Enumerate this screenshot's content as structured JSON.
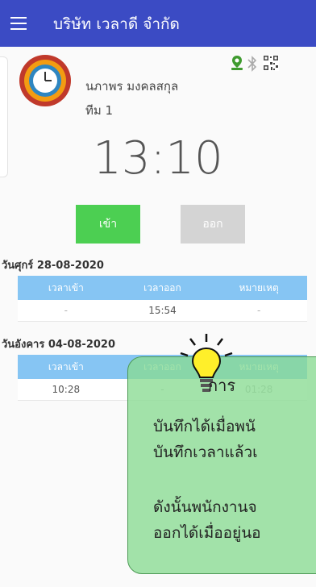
{
  "app_bar": {
    "title": "บริษัท เวลาดี จำกัด"
  },
  "employee": {
    "name": "นภาพร มงคลสกุล",
    "team": "ทีม 1"
  },
  "status_icons": [
    "location-pin-icon",
    "bluetooth-icon",
    "qr-code-icon"
  ],
  "clock": {
    "time": "13:10"
  },
  "actions": {
    "check_in_label": "เข้า",
    "check_out_label": "ออก"
  },
  "colors": {
    "app_bar": "#3b4bc4",
    "check_in": "#4ccf52",
    "check_out_disabled": "#d4d4d4",
    "table_header": "#86c5f3",
    "tip_fill": "#89db92"
  },
  "logs": [
    {
      "date": "วันศุกร์ 28-08-2020",
      "headers": [
        "เวลาเข้า",
        "เวลาออก",
        "หมายเหตุ"
      ],
      "row": [
        "-",
        "15:54",
        "-"
      ]
    },
    {
      "date": "วันอังคาร 04-08-2020",
      "headers": [
        "เวลาเข้า",
        "เวลาออก",
        "หมายเหตุ"
      ],
      "row": [
        "10:28",
        "-",
        "01:28"
      ]
    }
  ],
  "tip": {
    "heading": "การ",
    "line1": "บันทึกได้เมื่อพนั",
    "line2": "บันทึกเวลาแล้วเ",
    "line3": "ดังนั้นพนักงานจ",
    "line4": "ออกได้เมื่ออยู่นอ"
  }
}
